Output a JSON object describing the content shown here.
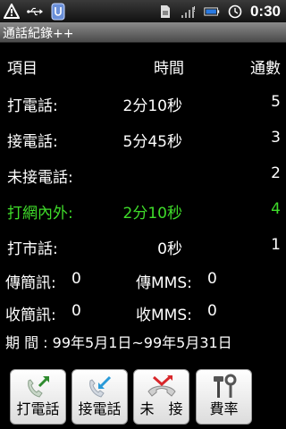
{
  "status_bar": {
    "time": "0:30"
  },
  "app": {
    "title": "通話紀錄++"
  },
  "table": {
    "headers": {
      "item": "項目",
      "time": "時間",
      "count": "通數"
    },
    "rows": [
      {
        "label": "打電話:",
        "time": "2分10秒",
        "count": "5",
        "highlight": false
      },
      {
        "label": "接電話:",
        "time": "5分45秒",
        "count": "3",
        "highlight": false
      },
      {
        "label": "未接電話:",
        "time": "",
        "count": "2",
        "highlight": false
      },
      {
        "label": "打網內外:",
        "time": "2分10秒",
        "count": "4",
        "highlight": true
      },
      {
        "label": "打市話:",
        "time": "0秒",
        "count": "1",
        "highlight": false
      }
    ]
  },
  "messages": {
    "sms_sent_label": "傳簡訊:",
    "sms_sent": "0",
    "mms_sent_label": "傳MMS:",
    "mms_sent": "0",
    "sms_recv_label": "收簡訊:",
    "sms_recv": "0",
    "mms_recv_label": "收MMS:",
    "mms_recv": "0"
  },
  "period": {
    "text": "期 間 : 99年5月1日~99年5月31日"
  },
  "buttons": {
    "outgoing": "打電話",
    "incoming": "接電話",
    "missed": "未　接",
    "rate": "費率"
  },
  "colors": {
    "highlight": "#3fdc2a",
    "background": "#000000"
  },
  "icons": [
    "warning-icon",
    "usb-icon",
    "app-notification-icon",
    "sim-icon",
    "no-signal-icon",
    "battery-icon",
    "alarm-icon",
    "outgoing-call-icon",
    "incoming-call-icon",
    "missed-call-icon",
    "tools-icon"
  ]
}
